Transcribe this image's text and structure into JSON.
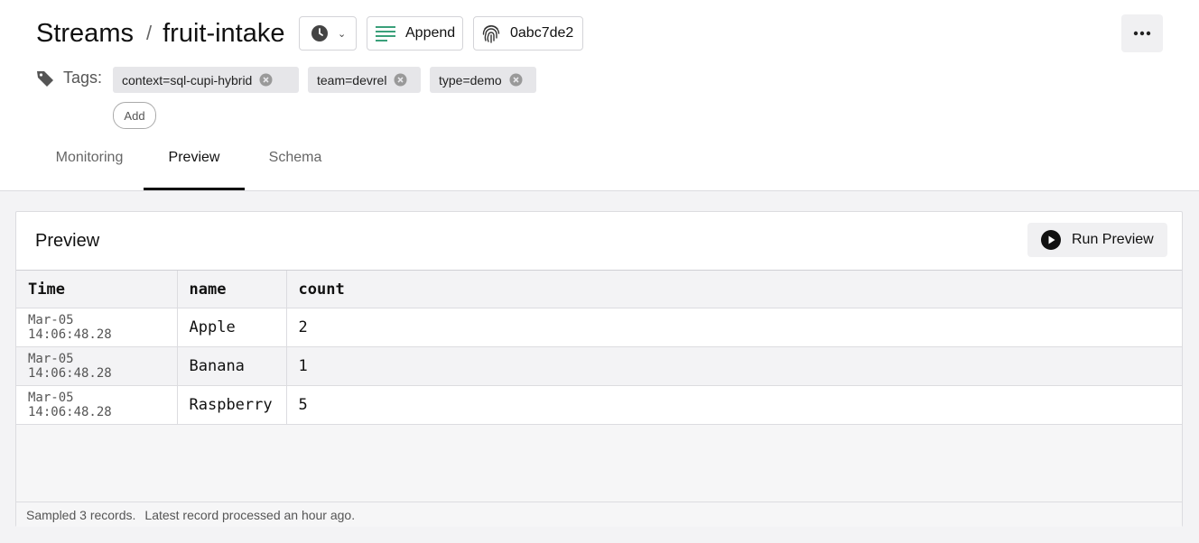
{
  "breadcrumb": {
    "parent": "Streams",
    "separator": "/",
    "current": "fruit-intake"
  },
  "toolbar": {
    "clock_icon": "clock-icon",
    "mode_label": "Append",
    "mode_icon": "lines-icon",
    "id_label": "0abc7de2",
    "id_icon": "fingerprint-icon",
    "more_icon": "ellipsis-icon"
  },
  "tags": {
    "label": "Tags:",
    "items": [
      {
        "label": "context=sql-cupi-hybrid"
      },
      {
        "label": "team=devrel"
      },
      {
        "label": "type=demo"
      }
    ],
    "add_label": "Add"
  },
  "tabs": [
    {
      "label": "Monitoring",
      "active": false
    },
    {
      "label": "Preview",
      "active": true
    },
    {
      "label": "Schema",
      "active": false
    }
  ],
  "preview": {
    "title": "Preview",
    "run_label": "Run Preview",
    "columns": [
      "Time",
      "name",
      "count"
    ],
    "rows": [
      {
        "time": "Mar-05 14:06:48.28",
        "name": "Apple",
        "count": "2"
      },
      {
        "time": "Mar-05 14:06:48.28",
        "name": "Banana",
        "count": "1"
      },
      {
        "time": "Mar-05 14:06:48.28",
        "name": "Raspberry",
        "count": "5"
      }
    ],
    "footer_sampled": "Sampled 3 records.",
    "footer_latest": "Latest record processed an hour ago."
  },
  "colors": {
    "accent": "#111111",
    "append_icon": "#3aa07a",
    "tag_bg": "#e6e6e9"
  }
}
